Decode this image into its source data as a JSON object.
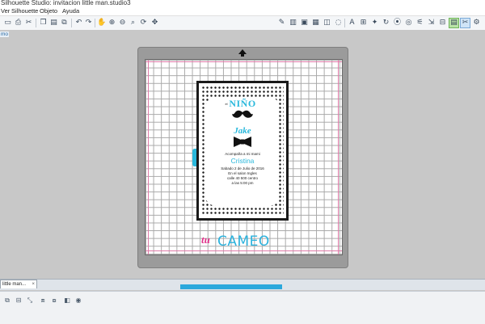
{
  "window": {
    "title": "Silhouette Studio: invitacion little man.studio3"
  },
  "menu": [
    "Ver",
    "Silhouette",
    "Objeto",
    "Ayuda"
  ],
  "toolbar": {
    "left_icons": [
      "new-file-icon",
      "print-icon",
      "cut-settings-icon",
      "copy-icon",
      "paste-icon",
      "duplicate-icon",
      "undo-icon",
      "redo-icon",
      "pan-icon",
      "zoom-in-icon",
      "zoom-out-icon",
      "zoom-fit-icon",
      "rotate-icon"
    ],
    "right_icons": [
      "pen-icon",
      "fill-icon",
      "image-icon",
      "media-icon",
      "rectangle-icon",
      "circle-icon",
      "polygon-icon",
      "text-icon",
      "align-icon",
      "replicate-icon",
      "transform-icon",
      "trace-icon",
      "offset-icon",
      "send-icon",
      "store-icon",
      "library-icon",
      "settings-icon"
    ]
  },
  "workspace": {
    "corner_label": "mo"
  },
  "card": {
    "el": "el",
    "nino": "NIÑO",
    "name": "Jake",
    "accompanied": "Acompaña a mi mami",
    "mom_name": "Cristina",
    "details": [
      "Sabado 2 de Julio de 2016",
      "En el salon Ingles",
      "calle 40 500 centro",
      "a las 5:00 pm"
    ]
  },
  "logo": {
    "prefix": "tu",
    "brand": "CAMEO"
  },
  "document_tab": {
    "label": "little man...",
    "close": "×"
  },
  "colors": {
    "accent": "#29b8dc",
    "brand_pink": "#e0328a",
    "mat_gray": "#9b9b9b"
  },
  "bottom_icons": [
    "group-icon",
    "ungroup-icon",
    "compound-icon",
    "release-icon",
    "weld-icon",
    "modify-icon"
  ]
}
